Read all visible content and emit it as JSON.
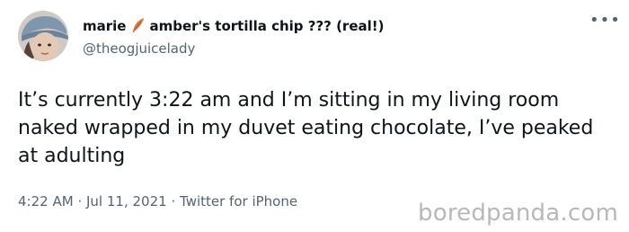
{
  "tweet": {
    "display_name_part1": "marie",
    "display_name_icon": "feather-icon",
    "display_name_part2": "amber's tortilla chip ??? (real!)",
    "handle": "@theogjuicelady",
    "more_icon": "more-options-icon",
    "text": "It’s currently 3:22 am and I’m sitting in my living room naked wrapped in my duvet eating chocolate, I’ve peaked at adulting",
    "time": "4:22 AM",
    "separator1": "·",
    "date": "Jul 11, 2021",
    "separator2": "·",
    "source": "Twitter for iPhone"
  },
  "watermark": "boredpanda.com",
  "colors": {
    "text": "#0f1419",
    "secondary_text": "#536471",
    "watermark": "#b8b8b8",
    "feather": "#e07a3a"
  }
}
